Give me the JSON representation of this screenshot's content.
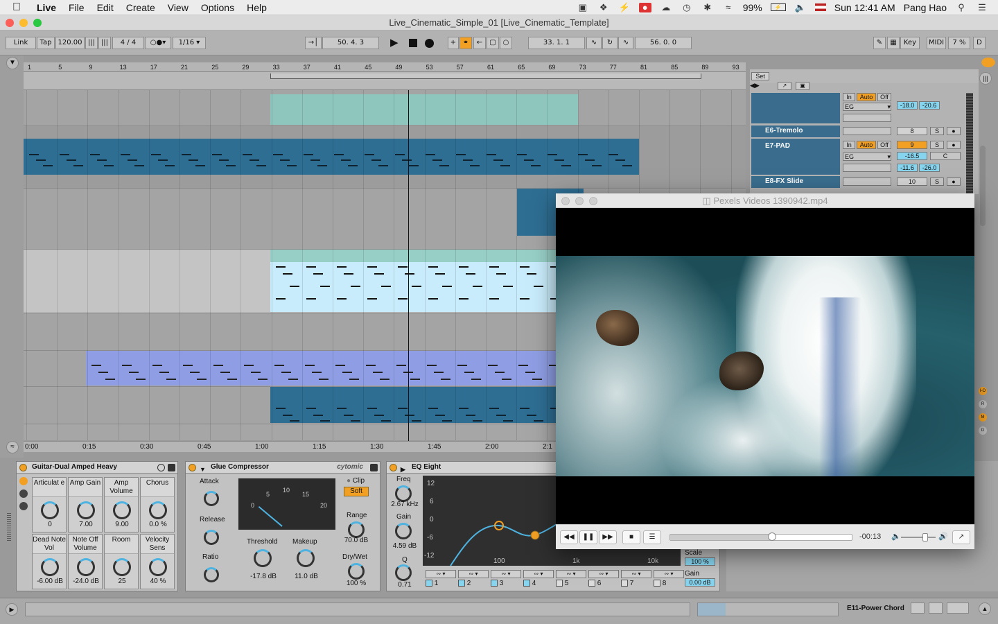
{
  "menubar": {
    "app": "Live",
    "items": [
      "File",
      "Edit",
      "Create",
      "View",
      "Options",
      "Help"
    ],
    "battery": "99%",
    "clock": "Sun 12:41 AM",
    "user": "Pang Hao"
  },
  "window": {
    "title": "Live_Cinematic_Simple_01  [Live_Cinematic_Template]"
  },
  "control": {
    "link": "Link",
    "tap": "Tap",
    "tempo": "120.00",
    "sig_num": "4",
    "sig_den": "4",
    "quant": "1/16",
    "position": "50.  4.  3",
    "loop_start": "33.  1.  1",
    "loop_len": "56.  0.  0",
    "key": "Key",
    "midi": "MIDI",
    "cpu": "7 %",
    "d": "D"
  },
  "ruler": {
    "bars": [
      "1",
      "5",
      "9",
      "13",
      "17",
      "21",
      "25",
      "29",
      "33",
      "37",
      "41",
      "45",
      "49",
      "53",
      "57",
      "61",
      "65",
      "69",
      "73",
      "77",
      "81",
      "85",
      "89",
      "93"
    ]
  },
  "timeline": {
    "times": [
      "0:00",
      "0:15",
      "0:30",
      "0:45",
      "1:00",
      "1:15",
      "1:30",
      "1:45",
      "2:00",
      "2:1"
    ]
  },
  "mixer": {
    "set": "Set",
    "tracks": [
      {
        "name": "E6-Tremolo",
        "num": "8"
      },
      {
        "name": "E7-PAD",
        "num": "9",
        "vol": "-16.5",
        "pan": "C",
        "in": "In",
        "auto": "Auto",
        "off": "Off",
        "route": "EG",
        "l": "-11.6",
        "r": "-26.0"
      },
      {
        "name": "E8-FX Slide",
        "num": "10"
      }
    ],
    "top": {
      "route": "EG",
      "l": "-18.0",
      "r": "-20.6",
      "in": "In",
      "auto": "Auto",
      "off": "Off"
    },
    "side_letters": [
      "I-O",
      "R",
      "M",
      "D"
    ]
  },
  "devices": {
    "guitar": {
      "title": "Guitar-Dual Amped Heavy",
      "macros": [
        {
          "label": "Articulat e",
          "value": "0"
        },
        {
          "label": "Amp Gain",
          "value": "7.00"
        },
        {
          "label": "Amp Volume",
          "value": "9.00"
        },
        {
          "label": "Chorus",
          "value": "0.0 %"
        },
        {
          "label": "Dead Note Vol",
          "value": "-6.00 dB"
        },
        {
          "label": "Note Off Volume",
          "value": "-24.0 dB"
        },
        {
          "label": "Room",
          "value": "25"
        },
        {
          "label": "Velocity Sens",
          "value": "40 %"
        }
      ]
    },
    "glue": {
      "title": "Glue Compressor",
      "brand": "cytomic",
      "attack": "Attack",
      "release": "Release",
      "ratio": "Ratio",
      "threshold_label": "Threshold",
      "threshold": "-17.8 dB",
      "makeup_label": "Makeup",
      "makeup": "11.0 dB",
      "clip": "Clip",
      "soft": "Soft",
      "range_label": "Range",
      "range": "70.0 dB",
      "drywet_label": "Dry/Wet",
      "drywet": "100 %",
      "meter_ticks": [
        "0",
        "5",
        "10",
        "15",
        "20"
      ],
      "attack_ticks": [
        ".3",
        "1",
        "3",
        ".1",
        "10",
        ".01",
        "30"
      ],
      "release_ticks": [
        ".4",
        ".6",
        ".8",
        ".2",
        "1.2",
        "A"
      ],
      "ratio_ticks": [
        "4",
        "2",
        "10"
      ]
    },
    "eq": {
      "title": "EQ Eight",
      "freq_label": "Freq",
      "freq": "2.67 kHz",
      "gain_label": "Gain",
      "gain": "4.59 dB",
      "q_label": "Q",
      "q": "0.71",
      "db_ticks": [
        "12",
        "6",
        "0",
        "-6",
        "-12"
      ],
      "f_ticks": [
        "100",
        "1k",
        "10k"
      ],
      "bands": [
        "1",
        "2",
        "3",
        "4",
        "5",
        "6",
        "7",
        "8"
      ],
      "scale_label": "Scale",
      "scale": "100 %",
      "gainout_label": "Gain",
      "gainout": "0.00 dB"
    }
  },
  "status": {
    "track": "E11-Power Chord"
  },
  "video": {
    "title": "Pexels Videos 1390942.mp4",
    "remaining": "-00:13",
    "progress": 0.56,
    "volume": 0.7
  }
}
